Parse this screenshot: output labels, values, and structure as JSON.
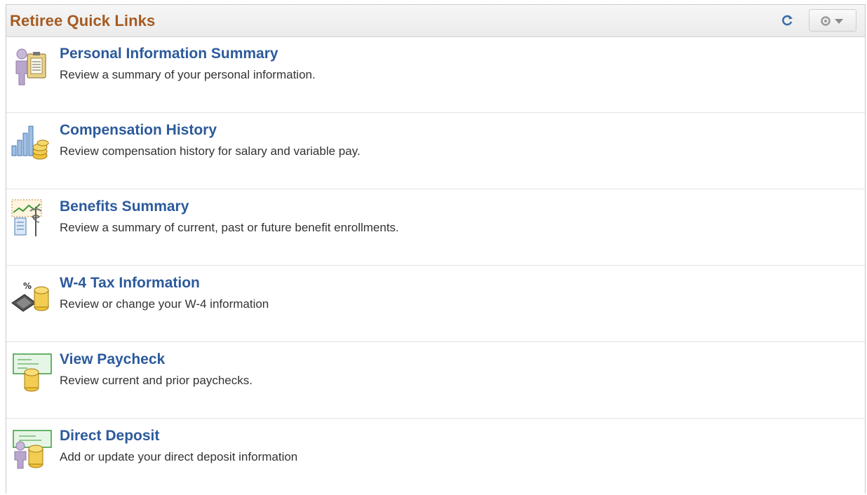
{
  "header": {
    "title": "Retiree Quick Links",
    "refresh_icon": "refresh-icon",
    "settings_icon": "gear-icon"
  },
  "colors": {
    "title": "#a65a21",
    "link": "#2c5a9c",
    "text": "#333333"
  },
  "links": [
    {
      "label": "Personal Information Summary",
      "description": "Review a summary of your personal information.",
      "icon": "person-clipboard-icon"
    },
    {
      "label": "Compensation History",
      "description": "Review compensation history for salary and variable pay.",
      "icon": "bar-chart-coins-icon"
    },
    {
      "label": "Benefits Summary",
      "description": "Review a summary of current, past or future benefit enrollments.",
      "icon": "benefits-caduceus-icon"
    },
    {
      "label": "W-4 Tax Information",
      "description": "Review or change your W-4 information",
      "icon": "calculator-coins-icon"
    },
    {
      "label": "View Paycheck",
      "description": "Review current and prior paychecks.",
      "icon": "paycheck-coins-icon"
    },
    {
      "label": "Direct Deposit",
      "description": "Add or update your direct deposit information",
      "icon": "deposit-person-coins-icon"
    }
  ]
}
